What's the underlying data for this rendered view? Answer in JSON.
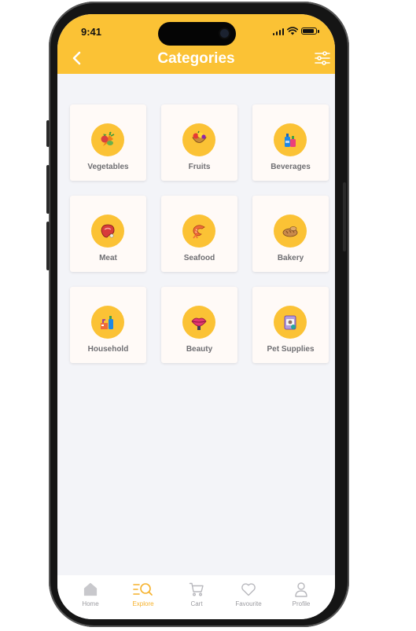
{
  "status": {
    "time": "9:41"
  },
  "header": {
    "title": "Categories"
  },
  "categories": [
    {
      "label": "Vegetables"
    },
    {
      "label": "Fruits"
    },
    {
      "label": "Beverages"
    },
    {
      "label": "Meat"
    },
    {
      "label": "Seafood"
    },
    {
      "label": "Bakery"
    },
    {
      "label": "Household"
    },
    {
      "label": "Beauty"
    },
    {
      "label": "Pet Supplies"
    }
  ],
  "tabbar": {
    "items": [
      {
        "label": "Home"
      },
      {
        "label": "Explore"
      },
      {
        "label": "Cart"
      },
      {
        "label": "Favourite"
      },
      {
        "label": "Profile"
      }
    ],
    "active": "Explore"
  },
  "colors": {
    "accent": "#fbc235",
    "active_tab": "#f6b12a",
    "background": "#f3f4f8",
    "card": "#fffaf7"
  }
}
